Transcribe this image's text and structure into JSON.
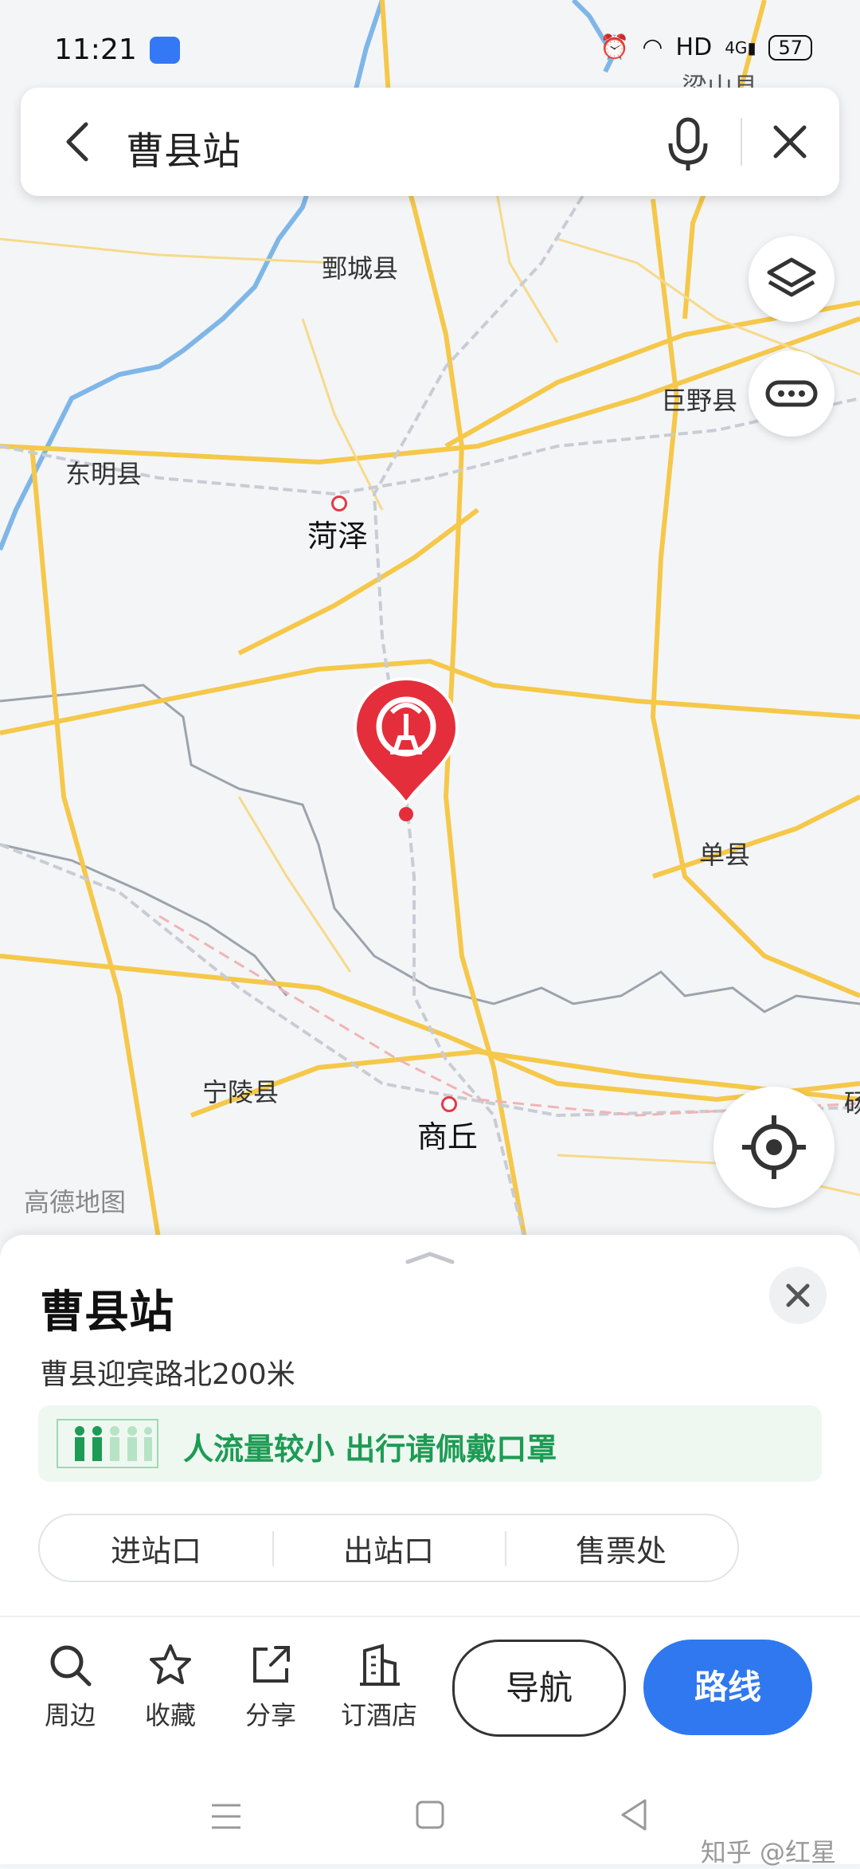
{
  "status_bar": {
    "time": "11:21",
    "network": "HD",
    "cell": "4G",
    "battery": "57"
  },
  "search": {
    "query": "曹县站"
  },
  "map": {
    "labels": {
      "liangshan": "梁山县",
      "juancheng": "鄄城县",
      "juye": "巨野县",
      "dongming": "东明县",
      "heze": "菏泽",
      "shanxian": "单县",
      "ningling": "宁陵县",
      "shangqiu": "商丘",
      "edge": "砀"
    },
    "watermark": "高德地图",
    "colors": {
      "road": "#f5c84a",
      "marker": "#e52e3b",
      "rail": "#c8ccd4"
    }
  },
  "sheet": {
    "title": "曹县站",
    "address": "曹县迎宾路北200米",
    "crowd_notice": "人流量较小 出行请佩戴口罩",
    "entrances": [
      "进站口",
      "出站口",
      "售票处"
    ],
    "actions": {
      "nearby": "周边",
      "favorite": "收藏",
      "share": "分享",
      "hotel": "订酒店",
      "navigate": "导航",
      "route": "路线"
    },
    "accent": "#2f78f0",
    "crowd_color": "#1d9b54"
  },
  "footer": {
    "watermark": "知乎 @红星"
  }
}
